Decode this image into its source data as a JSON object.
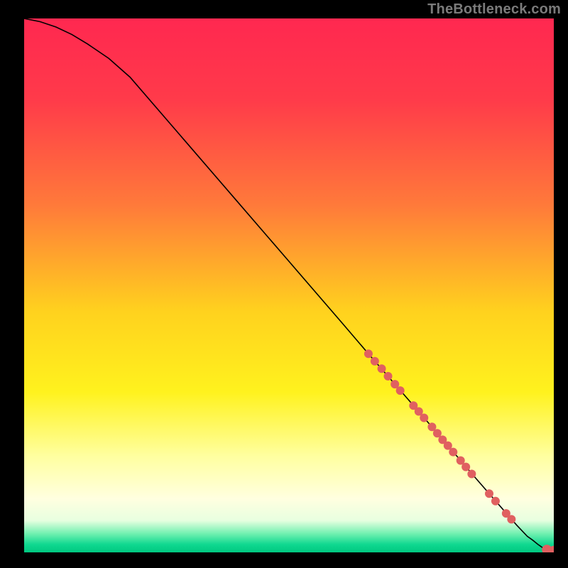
{
  "watermark": "TheBottleneck.com",
  "chart_data": {
    "type": "line",
    "title": "",
    "xlabel": "",
    "ylabel": "",
    "xlim": [
      0,
      100
    ],
    "ylim": [
      0,
      100
    ],
    "gradient_stops": [
      {
        "offset": 0.0,
        "color": "#ff2850"
      },
      {
        "offset": 0.15,
        "color": "#ff3a4a"
      },
      {
        "offset": 0.35,
        "color": "#ff7a3a"
      },
      {
        "offset": 0.55,
        "color": "#ffd21e"
      },
      {
        "offset": 0.7,
        "color": "#fff21e"
      },
      {
        "offset": 0.82,
        "color": "#ffffa0"
      },
      {
        "offset": 0.9,
        "color": "#ffffe0"
      },
      {
        "offset": 0.94,
        "color": "#e8ffe0"
      },
      {
        "offset": 0.965,
        "color": "#70f0b0"
      },
      {
        "offset": 0.985,
        "color": "#10d890"
      },
      {
        "offset": 1.0,
        "color": "#00c880"
      }
    ],
    "series": [
      {
        "name": "curve",
        "type": "line",
        "x": [
          0,
          3,
          6,
          9,
          12,
          16,
          20,
          30,
          40,
          50,
          60,
          65,
          70,
          75,
          80,
          85,
          90,
          93,
          95,
          96,
          97,
          98,
          99,
          100
        ],
        "y": [
          100,
          99.4,
          98.4,
          97.0,
          95.2,
          92.5,
          89,
          77.5,
          66,
          54.5,
          43,
          37.2,
          31.5,
          25.8,
          20,
          14.2,
          8.5,
          5.1,
          3,
          2.3,
          1.5,
          0.8,
          0.3,
          0.3
        ]
      },
      {
        "name": "markers",
        "type": "scatter",
        "marker_color": "#e06060",
        "points": [
          {
            "x": 65.0,
            "y": 37.2,
            "r": 6
          },
          {
            "x": 66.2,
            "y": 35.8,
            "r": 6
          },
          {
            "x": 67.5,
            "y": 34.4,
            "r": 6
          },
          {
            "x": 68.7,
            "y": 33.0,
            "r": 6
          },
          {
            "x": 70.0,
            "y": 31.5,
            "r": 6
          },
          {
            "x": 71.0,
            "y": 30.3,
            "r": 6
          },
          {
            "x": 73.5,
            "y": 27.5,
            "r": 6
          },
          {
            "x": 74.5,
            "y": 26.4,
            "r": 6
          },
          {
            "x": 75.5,
            "y": 25.2,
            "r": 6
          },
          {
            "x": 77.0,
            "y": 23.5,
            "r": 6
          },
          {
            "x": 78.0,
            "y": 22.3,
            "r": 6
          },
          {
            "x": 79.0,
            "y": 21.1,
            "r": 6
          },
          {
            "x": 80.0,
            "y": 20.0,
            "r": 6
          },
          {
            "x": 81.0,
            "y": 18.8,
            "r": 6
          },
          {
            "x": 82.4,
            "y": 17.2,
            "r": 6
          },
          {
            "x": 83.4,
            "y": 16.0,
            "r": 6
          },
          {
            "x": 84.5,
            "y": 14.7,
            "r": 6
          },
          {
            "x": 87.8,
            "y": 11.0,
            "r": 6
          },
          {
            "x": 89.0,
            "y": 9.6,
            "r": 6
          },
          {
            "x": 91.0,
            "y": 7.3,
            "r": 6
          },
          {
            "x": 92.0,
            "y": 6.2,
            "r": 6
          },
          {
            "x": 98.7,
            "y": 0.5,
            "r": 7
          },
          {
            "x": 100.0,
            "y": 0.3,
            "r": 7
          }
        ]
      }
    ]
  }
}
